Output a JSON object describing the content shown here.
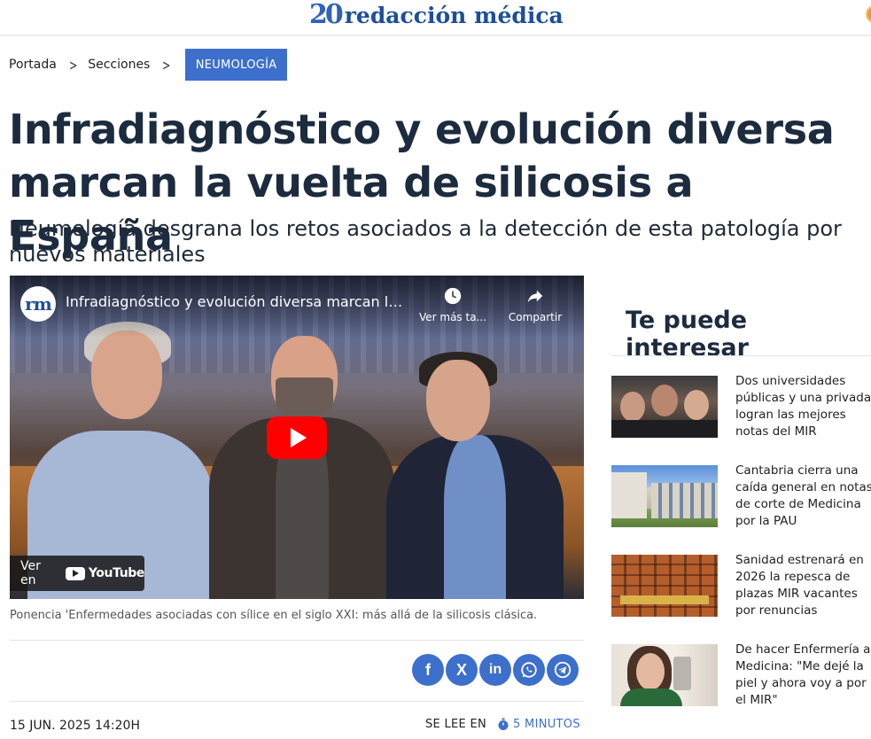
{
  "header": {
    "logo_number": "20",
    "logo_text": "redacción médica"
  },
  "breadcrumb": {
    "home": "Portada",
    "sections": "Secciones",
    "tag": "NEUMOLOGÍA"
  },
  "article": {
    "title": "Infradiagnóstico y evolución diversa marcan la vuelta de silicosis a España",
    "subtitle": "Neumología desgrana los retos asociados a la detección de esta patología por nuevos materiales",
    "caption": "Ponencia 'Enfermedades asociadas con sílice en el siglo XXI: más allá de la silicosis clásica.",
    "date": "15 JUN. 2025 14:20H",
    "read_label": "SE LEE EN",
    "read_time": "5 MINUTOS"
  },
  "video": {
    "channel_avatar": "rm",
    "title": "Infradiagnóstico y evolución diversa marcan la ...",
    "watch_later": "Ver más ta...",
    "share": "Compartir",
    "watch_on": "Ver en",
    "youtube": "YouTube"
  },
  "share": {
    "facebook": "f",
    "x": "X",
    "linkedin": "in"
  },
  "sidebar": {
    "title": "Te puede interesar",
    "items": [
      {
        "text": "Dos universidades públicas y una privada logran las mejores notas del MIR"
      },
      {
        "text": "Cantabria cierra una caída general en notas de corte de Medicina por la PAU"
      },
      {
        "text": "Sanidad estrenará en 2026 la repesca de plazas MIR vacantes por renuncias"
      },
      {
        "text": "De hacer Enfermería a Medicina: \"Me dejé la piel y ahora voy a por el MIR\""
      }
    ]
  },
  "colors": {
    "accent": "#3d6fcc",
    "title": "#1c2b3e",
    "play": "#ff0000"
  }
}
